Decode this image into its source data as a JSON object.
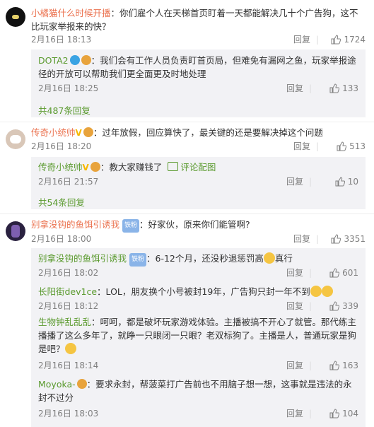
{
  "comments": [
    {
      "user": "小橘猫什么时候开播",
      "text": "：你们雇个人在天梯首页盯着一天都能解决几十个广告狗，这不比玩家举报来的快？",
      "time": "2月16日 18:13",
      "reply": "回复",
      "likes": "1724"
    },
    {
      "user": "传奇小统帅",
      "text": "：过年放假，回应算快了，最关键的还是要解决掉这个问题",
      "time": "2月16日 18:20",
      "reply": "回复",
      "likes": "513"
    },
    {
      "user": "别拿没钩的鱼饵引诱我",
      "fan_badge": "铁粉",
      "text": "：好家伙，原来你们能管啊?",
      "time": "2月16日 18:00",
      "reply": "回复",
      "likes": "3351"
    }
  ],
  "replies1": [
    {
      "user": "DOTA2",
      "text": "：我们会有工作人员负责盯首页局，但难免有漏网之鱼，玩家举报途径的开放可以帮助我们更全面更及时地处理",
      "time": "2月16日 18:25",
      "reply": "回复",
      "likes": "133"
    }
  ],
  "more1": "共487条回复",
  "replies2": [
    {
      "user": "传奇小统帅",
      "text": "：教大家赚钱了",
      "pic_label": "评论配图",
      "time": "2月16日 21:57",
      "reply": "回复",
      "likes": "10"
    }
  ],
  "more2": "共54条回复",
  "replies3": [
    {
      "user": "别拿没钩的鱼饵引诱我",
      "fan_badge": "铁粉",
      "text": "：6-12个月，还没秒退惩罚高",
      "text_after": "真行",
      "time": "2月16日 18:02",
      "reply": "回复",
      "likes": "601"
    },
    {
      "user": "长阳街dev1ce",
      "text": "：LOL，朋友换个小号被封19年，广告狗只封一年不到",
      "time": "2月16日 18:12",
      "reply": "回复",
      "likes": "339"
    },
    {
      "user": "生物钟乱乱乱",
      "text": "：呵呵，都是破坏玩家游戏体验。主播被搞不开心了就管。那代练主播播了这么多年了，就睁一只眼闭一只眼？老双标狗了。主播是人，普通玩家是狗是吧？",
      "time": "2月16日 18:14",
      "reply": "回复",
      "likes": "163"
    },
    {
      "user": "Moyoka-",
      "text": "：要求永封，帮菠菜打广告前也不用脑子想一想，这事就是违法的永封不过分",
      "time": "2月16日 18:03",
      "reply": "回复",
      "likes": "104"
    }
  ],
  "colors": {
    "accent_name": "#eb7350",
    "reply_name": "#5a9a2e",
    "sub_bg": "#f2f2f5"
  }
}
